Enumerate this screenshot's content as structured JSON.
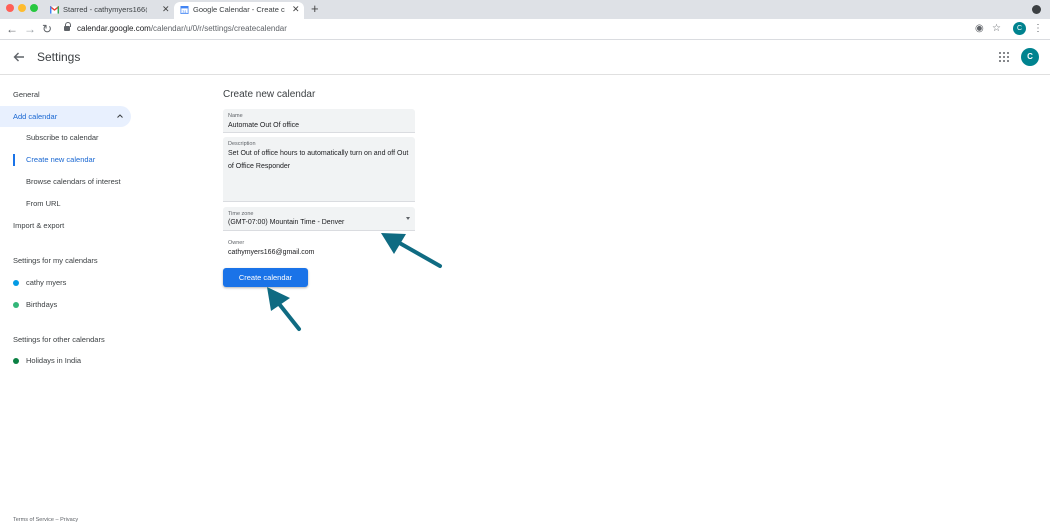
{
  "browser": {
    "tabs": [
      {
        "title": "Starred - cathymyers166@gm",
        "active": false,
        "favicon": "gmail-icon"
      },
      {
        "title": "Google Calendar - Create cale",
        "active": true,
        "favicon": "calendar-icon"
      }
    ],
    "url_host": "calendar.google.com",
    "url_path": "/calendar/u/0/r/settings/createcalendar",
    "profile_initial": "C"
  },
  "header": {
    "title": "Settings",
    "avatar_initial": "C"
  },
  "sidebar": {
    "general": "General",
    "add_calendar": "Add calendar",
    "sub_items": [
      "Subscribe to calendar",
      "Create new calendar",
      "Browse calendars of interest",
      "From URL"
    ],
    "import_export": "Import & export",
    "my_calendars_heading": "Settings for my calendars",
    "my_calendars": [
      {
        "name": "cathy myers",
        "color": "#039be5"
      },
      {
        "name": "Birthdays",
        "color": "#33b679"
      }
    ],
    "other_calendars_heading": "Settings for other calendars",
    "other_calendars": [
      {
        "name": "Holidays in India",
        "color": "#0b8043"
      }
    ]
  },
  "form": {
    "title": "Create new calendar",
    "name_label": "Name",
    "name_value": "Automate Out Of office",
    "description_label": "Description",
    "description_value": "Set Out of office hours to automatically turn on and off Out of Office Responder",
    "timezone_label": "Time zone",
    "timezone_value": "(GMT-07:00) Mountain Time - Denver",
    "owner_label": "Owner",
    "owner_value": "cathymyers166@gmail.com",
    "create_button": "Create calendar"
  },
  "footer": {
    "terms": "Terms of Service",
    "separator": "–",
    "privacy": "Privacy"
  },
  "colors": {
    "accent": "#1a73e8",
    "active_bg": "#e8f0fe",
    "annotation_arrow": "#0f6b82"
  }
}
